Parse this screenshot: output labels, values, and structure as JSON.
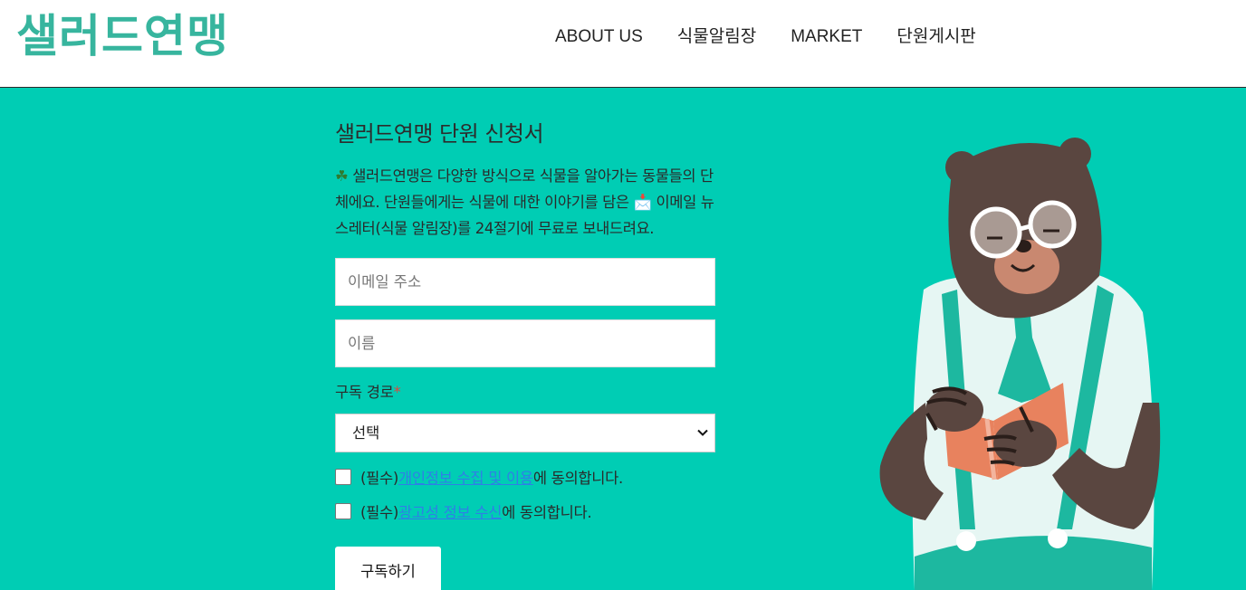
{
  "header": {
    "logo": "샐러드연맹",
    "nav": [
      "ABOUT US",
      "식물알림장",
      "MARKET",
      "단원게시판"
    ]
  },
  "form": {
    "title": "샐러드연맹 단원 신청서",
    "desc_clover": "☘",
    "desc_part1": " 샐러드연맹은 다양한 방식으로 식물을 알아가는 동물들의 단체에요. 단원들에게는 식물에 대한 이야기를 담은 ",
    "desc_mail": "📩",
    "desc_part2": " 이메일 뉴스레터(식물 알림장)를 24절기에 무료로 보내드려요.",
    "email_placeholder": "이메일 주소",
    "name_placeholder": "이름",
    "route_label": "구독 경로",
    "required_mark": "*",
    "route_selected": "선택",
    "consent1_prefix": "(필수) ",
    "consent1_link": "개인정보 수집 및 이용",
    "consent1_suffix": "에 동의합니다.",
    "consent2_prefix": "(필수) ",
    "consent2_link": "광고성 정보 수신",
    "consent2_suffix": "에 동의합니다.",
    "submit_label": "구독하기"
  },
  "colors": {
    "background": "#00cdb4",
    "logo": "#37b59e",
    "link": "#2f7fe6"
  }
}
